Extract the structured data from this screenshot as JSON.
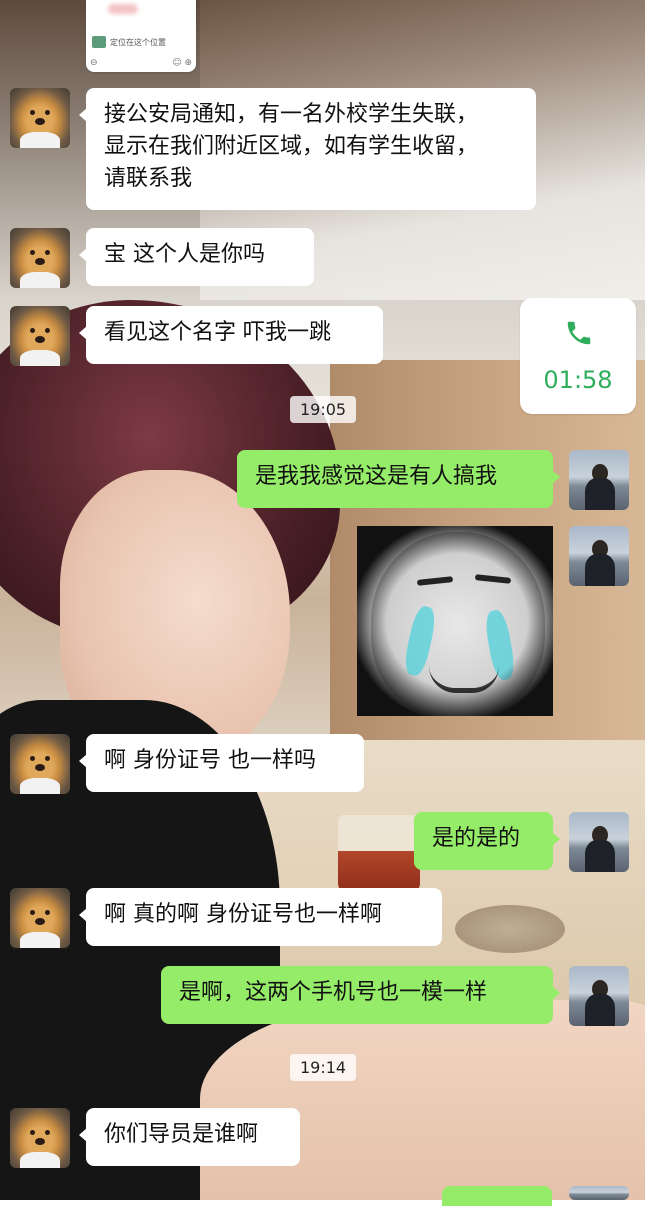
{
  "top_card": {
    "location_text": "定位在这个位置",
    "left_ctrl": "⊖",
    "right_ctrl": "☺ ⊕"
  },
  "messages": {
    "m1": "接公安局通知，有一名外校学生失联，\n显示在我们附近区域，如有学生收留，\n请联系我",
    "m2": "宝 这个人是你吗",
    "m3": "看见这个名字 吓我一跳",
    "m4": "是我我感觉这是有人搞我",
    "m5": "啊 身份证号 也一样吗",
    "m6": "是的是的",
    "m7": "啊 真的啊 身份证号也一样啊",
    "m8": "是啊，这两个手机号也一模一样",
    "m9": "你们导员是谁啊"
  },
  "call": {
    "duration": "01:58",
    "icon": "phone-icon",
    "color": "#2fae5c"
  },
  "timestamps": {
    "t1": "19:05",
    "t2": "19:14"
  },
  "sticker": {
    "icon": "crying-face-sticker"
  },
  "colors": {
    "outgoing_bubble": "#95ec69",
    "incoming_bubble": "#ffffff"
  }
}
